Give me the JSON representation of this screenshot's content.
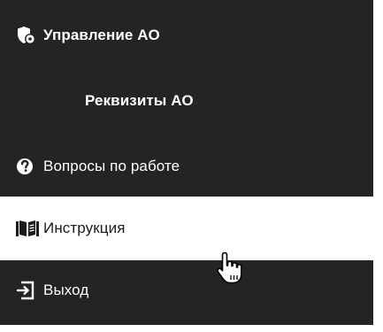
{
  "menu": {
    "items": [
      {
        "label": "Управление АО",
        "icon": "shield-gear-icon"
      },
      {
        "label": "Реквизиты АО"
      },
      {
        "label": "Вопросы по работе",
        "icon": "question-circle-icon"
      },
      {
        "label": "Инструкция",
        "icon": "open-book-icon",
        "active": true
      },
      {
        "label": "Выход",
        "icon": "logout-arrow-icon"
      }
    ]
  },
  "colors": {
    "panel_background": "#242424",
    "active_background": "#ffffff",
    "text_light": "#ffffff",
    "text_dark": "#1b1b1b"
  },
  "cursor": {
    "icon": "hand-pointer-icon"
  }
}
